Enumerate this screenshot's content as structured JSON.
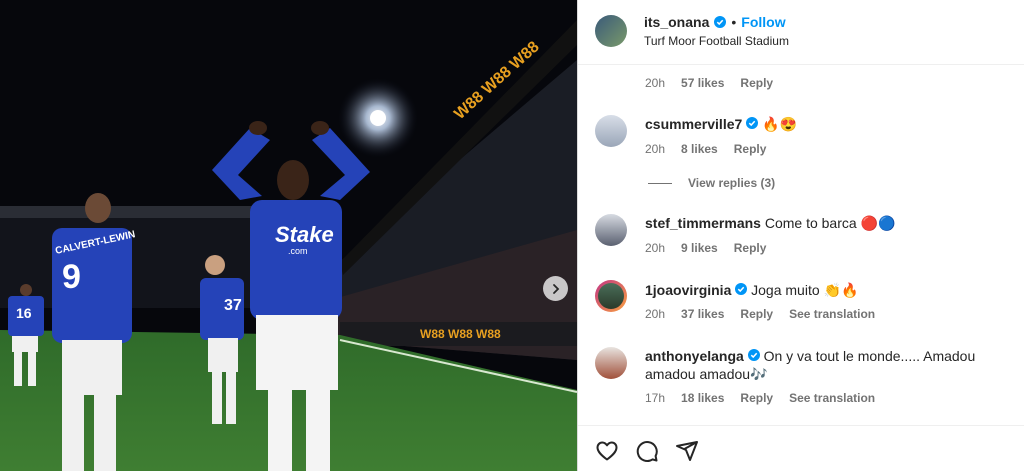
{
  "post": {
    "author": "its_onana",
    "follow_label": "Follow",
    "separator": "•",
    "location": "Turf Moor Football Stadium"
  },
  "comments": [
    {
      "username": "",
      "text": "",
      "time": "20h",
      "likes": "57 likes",
      "reply": "Reply",
      "translate": ""
    },
    {
      "username": "csummerville7",
      "verified": true,
      "text": "🔥😍",
      "time": "20h",
      "likes": "8 likes",
      "reply": "Reply",
      "translate": ""
    },
    {
      "username": "stef_timmermans",
      "verified": false,
      "text": "Come to barca 🔴🔵",
      "time": "20h",
      "likes": "9 likes",
      "reply": "Reply",
      "translate": ""
    },
    {
      "username": "1joaovirginia",
      "verified": true,
      "text": "Joga muito 👏🔥",
      "time": "20h",
      "likes": "37 likes",
      "reply": "Reply",
      "translate": "See translation"
    },
    {
      "username": "anthonyelanga",
      "verified": true,
      "text": "On y va tout le monde..... Amadou amadou amadou🎶",
      "time": "17h",
      "likes": "18 likes",
      "reply": "Reply",
      "translate": "See translation"
    }
  ],
  "view_replies": "View replies (3)",
  "photo": {
    "jersey_numbers": [
      "9",
      "37",
      "16"
    ],
    "sponsor": "Stake",
    "sponsor_sub": ".com",
    "board_text": "W88",
    "name_on_shirt": "CALVERT-LEWIN"
  },
  "icons": [
    "heart-icon",
    "comment-icon",
    "share-icon",
    "verified-badge-icon",
    "chevron-right-icon"
  ],
  "colors": {
    "accent": "#0095f6",
    "text": "#262626",
    "muted": "#737373",
    "everton_blue": "#1f3fb0"
  }
}
